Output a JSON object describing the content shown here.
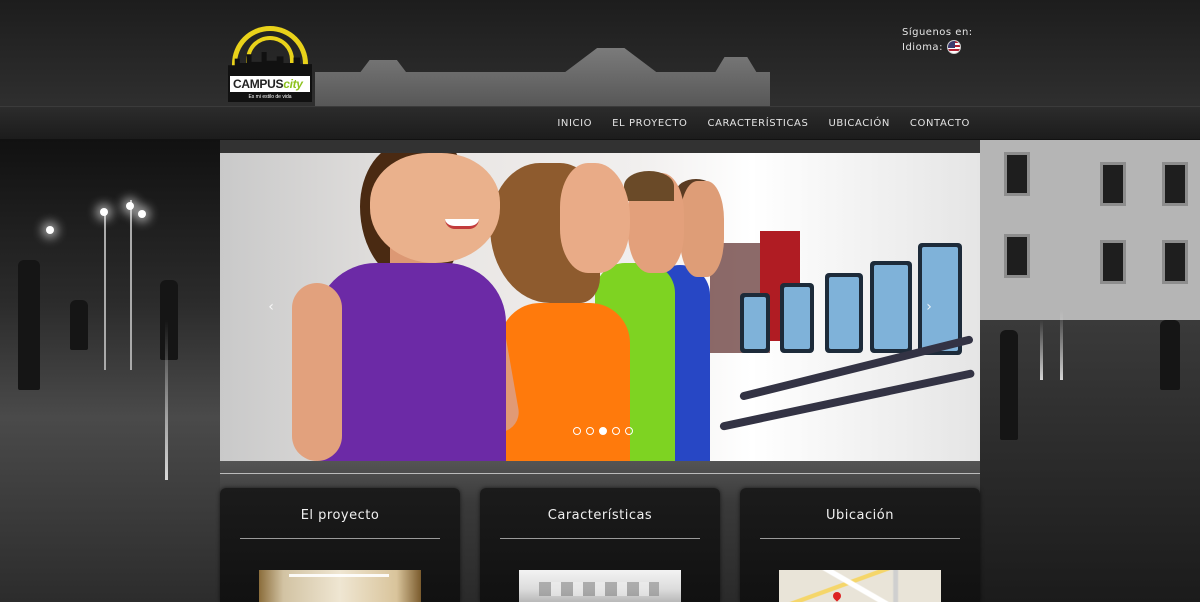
{
  "header": {
    "logo": {
      "name_main": "CAMPUS",
      "name_accent": "city",
      "tagline": "Es mi estilo de vida"
    },
    "social_label": "Síguenos en:",
    "language_label": "Idioma:",
    "language_flag_icon": "us-flag-icon"
  },
  "nav": {
    "items": [
      {
        "label": "INICIO"
      },
      {
        "label": "EL PROYECTO"
      },
      {
        "label": "CARACTERÍSTICAS"
      },
      {
        "label": "UBICACIÓN"
      },
      {
        "label": "CONTACTO"
      }
    ]
  },
  "slider": {
    "prev_icon": "chevron-left-icon",
    "next_icon": "chevron-right-icon",
    "prev_glyph": "‹",
    "next_glyph": "›",
    "slide_count": 5,
    "active_index": 3
  },
  "cards": [
    {
      "title": "El proyecto"
    },
    {
      "title": "Características"
    },
    {
      "title": "Ubicación"
    }
  ],
  "colors": {
    "logo_yellow": "#e9d21a",
    "logo_green": "#8dc21f",
    "nav_bg": "#1c1c1c",
    "card_bg": "#111111"
  }
}
